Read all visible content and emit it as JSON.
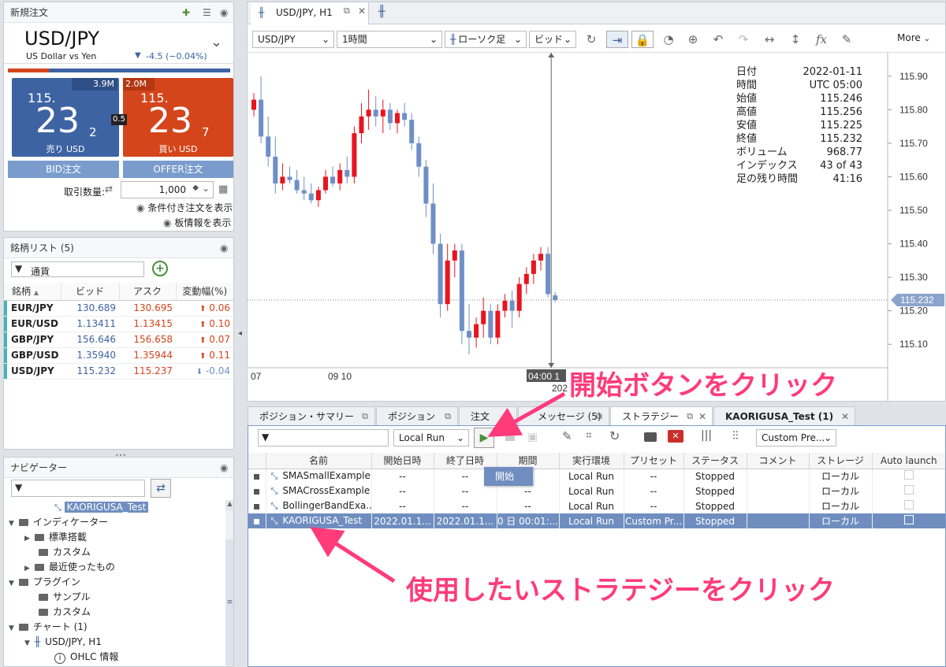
{
  "order": {
    "title": "新規注文",
    "symbol": "USD/JPY",
    "symbol_desc": "US Dollar vs Yen",
    "change": "-4.5 (−0.04%)",
    "bid_volume": "3.9M",
    "ask_volume": "2.0M",
    "bid_big_prefix": "115.",
    "bid_big": "23",
    "bid_pip": "2",
    "ask_big_prefix": "115.",
    "ask_big": "23",
    "ask_pip": "7",
    "spread": "0.5",
    "bid_label": "売り USD",
    "ask_label": "買い USD",
    "bid_order_btn": "BID注文",
    "offer_order_btn": "OFFER注文",
    "qty_label": "取引数量:",
    "qty_value": "1,000",
    "conditional_link": "条件付き注文を表示",
    "board_link": "板情報を表示"
  },
  "watchlist": {
    "title": "銘柄リスト (5)",
    "filter_value": "通貨",
    "headers": [
      "銘柄",
      "ビッド",
      "アスク",
      "変動幅(%)"
    ],
    "rows": [
      {
        "symbol": "EUR/JPY",
        "bid": "130.689",
        "ask": "130.695",
        "change": "0.06",
        "dir": "up"
      },
      {
        "symbol": "EUR/USD",
        "bid": "1.13411",
        "ask": "1.13415",
        "change": "0.10",
        "dir": "up"
      },
      {
        "symbol": "GBP/JPY",
        "bid": "156.646",
        "ask": "156.658",
        "change": "0.07",
        "dir": "up"
      },
      {
        "symbol": "GBP/USD",
        "bid": "1.35940",
        "ask": "1.35944",
        "change": "0.11",
        "dir": "up"
      },
      {
        "symbol": "USD/JPY",
        "bid": "115.232",
        "ask": "115.237",
        "change": "-0.04",
        "dir": "down"
      }
    ]
  },
  "navigator": {
    "title": "ナビゲーター",
    "items": [
      "KAORIGUSA_Test",
      "インディケーター",
      "標準搭載",
      "カスタム",
      "最近使ったもの",
      "プラグイン",
      "サンプル",
      "カスタム",
      "チャート (1)",
      "USD/JPY, H1",
      "OHLC 情報"
    ]
  },
  "chart": {
    "tab_title": "USD/JPY, H1",
    "symbol_select": "USD/JPY",
    "period_select": "1時間",
    "type_select": "ローソク足",
    "price_select": "ビッド",
    "more_label": "More",
    "info_labels": [
      "日付",
      "時間",
      "始値",
      "高値",
      "安値",
      "終値",
      "ボリューム",
      "インデックス",
      "足の残り時間"
    ],
    "info_values": [
      "2022-01-11",
      "UTC 05:00",
      "115.246",
      "115.256",
      "115.225",
      "115.232",
      "968.77",
      "43 of 43",
      "41:16"
    ],
    "price_ticks": [
      "115.90",
      "115.80",
      "115.70",
      "115.60",
      "115.50",
      "115.40",
      "115.30",
      "115.20",
      "115.10"
    ],
    "current_price": "115.232",
    "date_ticks": [
      "07",
      "09 10",
      "04:00 1",
      "202"
    ]
  },
  "chart_data": {
    "type": "candlestick",
    "title": "USD/JPY, H1",
    "ylim": [
      115.03,
      115.97
    ],
    "candles": [
      [
        115.8,
        115.85,
        115.78,
        115.83
      ],
      [
        115.83,
        115.9,
        115.7,
        115.72
      ],
      [
        115.72,
        115.78,
        115.63,
        115.66
      ],
      [
        115.66,
        115.72,
        115.55,
        115.58
      ],
      [
        115.58,
        115.64,
        115.56,
        115.6
      ],
      [
        115.6,
        115.63,
        115.58,
        115.59
      ],
      [
        115.59,
        115.62,
        115.55,
        115.56
      ],
      [
        115.56,
        115.6,
        115.53,
        115.55
      ],
      [
        115.55,
        115.58,
        115.52,
        115.53
      ],
      [
        115.53,
        115.57,
        115.51,
        115.56
      ],
      [
        115.56,
        115.62,
        115.55,
        115.6
      ],
      [
        115.6,
        115.63,
        115.57,
        115.58
      ],
      [
        115.58,
        115.64,
        115.56,
        115.62
      ],
      [
        115.62,
        115.66,
        115.58,
        115.6
      ],
      [
        115.6,
        115.75,
        115.58,
        115.73
      ],
      [
        115.73,
        115.82,
        115.7,
        115.78
      ],
      [
        115.78,
        115.86,
        115.74,
        115.8
      ],
      [
        115.8,
        115.84,
        115.75,
        115.78
      ],
      [
        115.78,
        115.83,
        115.73,
        115.8
      ],
      [
        115.8,
        115.82,
        115.74,
        115.76
      ],
      [
        115.76,
        115.8,
        115.73,
        115.79
      ],
      [
        115.79,
        115.82,
        115.75,
        115.77
      ],
      [
        115.77,
        115.79,
        115.68,
        115.7
      ],
      [
        115.7,
        115.72,
        115.6,
        115.63
      ],
      [
        115.63,
        115.65,
        115.48,
        115.52
      ],
      [
        115.52,
        115.58,
        115.37,
        115.4
      ],
      [
        115.4,
        115.43,
        115.18,
        115.22
      ],
      [
        115.22,
        115.4,
        115.2,
        115.35
      ],
      [
        115.35,
        115.4,
        115.3,
        115.38
      ],
      [
        115.38,
        115.4,
        115.1,
        115.14
      ],
      [
        115.14,
        115.22,
        115.07,
        115.12
      ],
      [
        115.12,
        115.18,
        115.09,
        115.16
      ],
      [
        115.16,
        115.24,
        115.12,
        115.2
      ],
      [
        115.2,
        115.22,
        115.1,
        115.12
      ],
      [
        115.12,
        115.22,
        115.1,
        115.2
      ],
      [
        115.2,
        115.25,
        115.18,
        115.23
      ],
      [
        115.23,
        115.26,
        115.15,
        115.2
      ],
      [
        115.2,
        115.3,
        115.18,
        115.28
      ],
      [
        115.28,
        115.33,
        115.25,
        115.31
      ],
      [
        115.31,
        115.37,
        115.28,
        115.35
      ],
      [
        115.35,
        115.39,
        115.32,
        115.37
      ],
      [
        115.37,
        115.39,
        115.24,
        115.25
      ],
      [
        115.246,
        115.256,
        115.225,
        115.232
      ]
    ]
  },
  "bottom_tabs": [
    "ポジション・サマリー",
    "ポジション",
    "注文",
    "メッセージ (5)",
    "ストラテジー",
    "KAORIGUSA_Test (1)"
  ],
  "strategy": {
    "run_mode": "Local Run",
    "preset_select": "Custom Pre...",
    "start_tooltip": "開始",
    "headers": [
      "名前",
      "開始日時",
      "終了日時",
      "期間",
      "実行環境",
      "プリセット",
      "ステータス",
      "コメント",
      "ストレージ",
      "Auto launch"
    ],
    "rows": [
      [
        "SMASmallExample",
        "--",
        "--",
        "--",
        "Local Run",
        "--",
        "Stopped",
        "",
        "ローカル"
      ],
      [
        "SMACrossExample",
        "--",
        "--",
        "--",
        "Local Run",
        "--",
        "Stopped",
        "",
        "ローカル"
      ],
      [
        "BollingerBandExa...",
        "--",
        "--",
        "--",
        "Local Run",
        "--",
        "Stopped",
        "",
        "ローカル"
      ],
      [
        "KAORIGUSA_Test",
        "2022.01.1...",
        "2022.01.1...",
        "0 日 00:01:...",
        "Local Run",
        "Custom Pr...",
        "Stopped",
        "",
        "ローカル"
      ]
    ]
  },
  "annotations": {
    "top": "開始ボタンをクリック",
    "bottom": "使用したいストラテジーをクリック"
  },
  "colors": {
    "bid": "#3d63a3",
    "ask": "#d4451c",
    "up": "#e8141e",
    "down": "#6f8fc6",
    "annotation": "#ff3b7a"
  }
}
